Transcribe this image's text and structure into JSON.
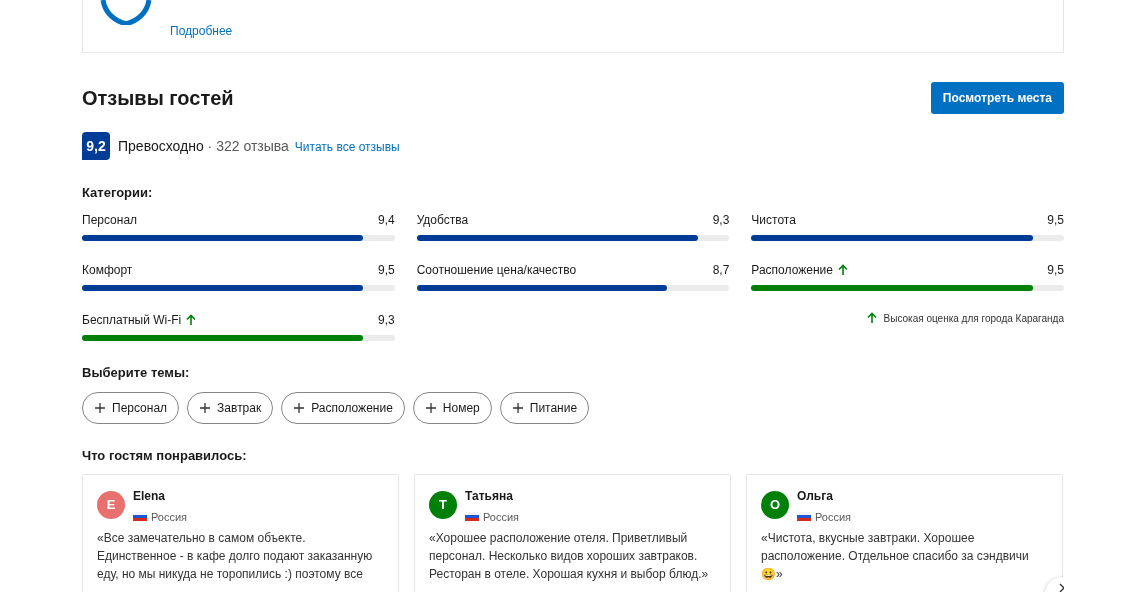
{
  "top_card": {
    "link": "Подробнее"
  },
  "header": {
    "title": "Отзывы гостей",
    "button": "Посмотреть места"
  },
  "summary": {
    "score": "9,2",
    "rating": "Превосходно",
    "count": "· 322 отзыва",
    "link": "Читать все отзывы"
  },
  "categories": {
    "title": "Категории:",
    "items": [
      {
        "label": "Персонал",
        "score": "9,4",
        "level": 0.9,
        "high": false
      },
      {
        "label": "Удобства",
        "score": "9,3",
        "level": 0.9,
        "high": false
      },
      {
        "label": "Чистота",
        "score": "9,5",
        "level": 0.9,
        "high": false
      },
      {
        "label": "Комфорт",
        "score": "9,5",
        "level": 0.9,
        "high": false
      },
      {
        "label": "Соотношение цена/качество",
        "score": "8,7",
        "level": 0.8,
        "high": false
      },
      {
        "label": "Расположение",
        "score": "9,5",
        "level": 0.9,
        "high": true
      },
      {
        "label": "Бесплатный Wi-Fi",
        "score": "9,3",
        "level": 0.9,
        "high": true
      }
    ],
    "legend": "Высокая оценка для города Караганда"
  },
  "topics": {
    "title": "Выберите темы:",
    "chips": [
      "Персонал",
      "Завтрак",
      "Расположение",
      "Номер",
      "Питание"
    ]
  },
  "liked": {
    "title": "Что гостям понравилось:",
    "reviews": [
      {
        "initial": "E",
        "name": "Elena",
        "country": "Россия",
        "color": "#e8706f",
        "text": "«Все замечательно в самом объекте. Единственное - в кафе долго подают заказанную еду, но мы никуда не торопились :) поэтому все"
      },
      {
        "initial": "Т",
        "name": "Татьяна",
        "country": "Россия",
        "color": "#008009",
        "text": "«Хорошее расположение отеля. Приветливый персонал. Несколько видов хороших завтраков. Ресторан в отеле. Хорошая кухня и выбор блюд.»"
      },
      {
        "initial": "О",
        "name": "Ольга",
        "country": "Россия",
        "color": "#008009",
        "text": "«Чистота, вкусные завтраки. Хорошее расположение. Отдельное спасибо за сэндвичи 😀»"
      }
    ]
  }
}
